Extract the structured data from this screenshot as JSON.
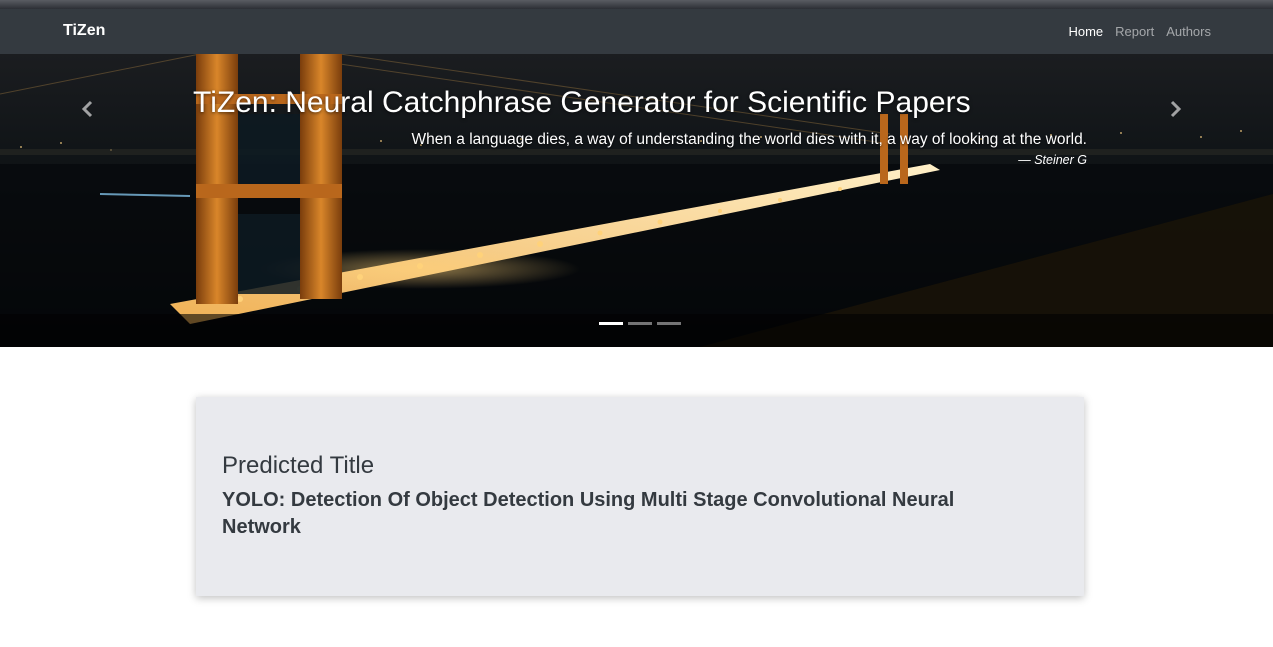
{
  "navbar": {
    "brand": "TiZen",
    "links": [
      {
        "label": "Home",
        "active": true
      },
      {
        "label": "Report",
        "active": false
      },
      {
        "label": "Authors",
        "active": false
      }
    ]
  },
  "carousel": {
    "title": "TiZen: Neural Catchphrase Generator for Scientific Papers",
    "quote": "When a language dies, a way of understanding the world dies with it, a way of looking at the world.",
    "author": "— Steiner G",
    "prev_icon": "chevron-left-icon",
    "next_icon": "chevron-right-icon",
    "slides_count": 3,
    "active_slide": 1
  },
  "card": {
    "label": "Predicted Title",
    "title": "YOLO: Detection Of Object Detection Using Multi Stage Convolutional Neural Network"
  },
  "colors": {
    "navbar_bg": "#343a40",
    "card_bg": "#e9eaee",
    "text_dark": "#343a40",
    "bridge_orange": "#c8721e"
  }
}
